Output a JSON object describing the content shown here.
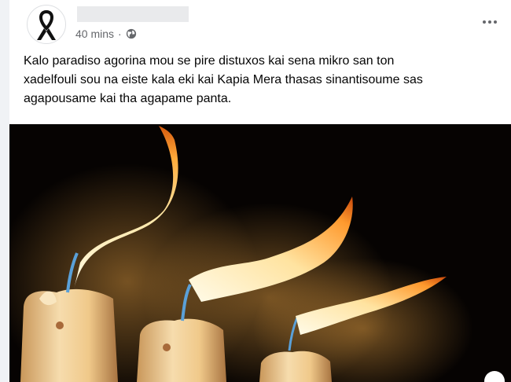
{
  "post": {
    "timestamp": "40 mins",
    "separator": "·",
    "audience_icon": "globe-icon",
    "options_icon": "more-options-icon",
    "avatar_icon": "black-ribbon-icon",
    "caption_line1": "Kalo paradiso agorina mou se pire distuxos kai sena mikro san ton",
    "caption_line2": "xadelfouli sou na eiste kala eki kai Kapia Mera thasas sinantisoume sas",
    "caption_line3": "agapousame kai tha agapame panta.",
    "photo_subject": "three burning candles"
  },
  "colors": {
    "page_bg": "#f0f2f5",
    "card_bg": "#ffffff",
    "secondary_text": "#65676b",
    "flame_core": "#fff6d8",
    "flame_outer": "#ff8a1a",
    "wax": "#f2d7a8"
  }
}
